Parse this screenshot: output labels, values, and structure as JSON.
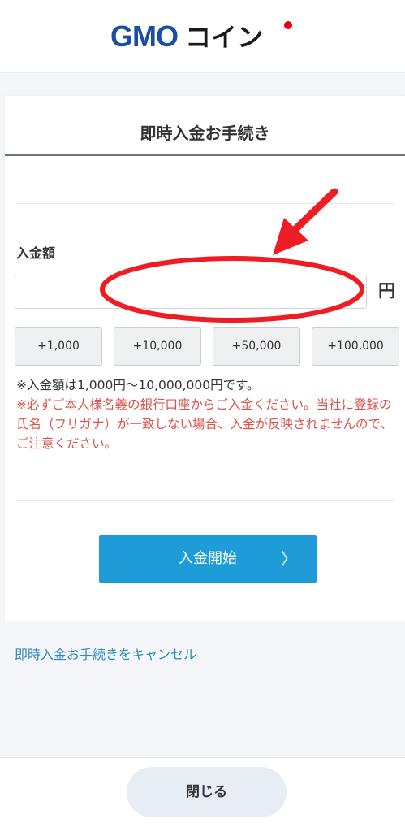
{
  "brand": {
    "logo_text": "GMOコイン",
    "logo_color": "#1a4ea2",
    "dot_color": "#e60012"
  },
  "card": {
    "title": "即時入金お手続き",
    "amount_label": "入金額",
    "amount_value": "",
    "unit": "円",
    "presets": [
      "+1,000",
      "+10,000",
      "+50,000",
      "+100,000"
    ],
    "note": "※入金額は1,000円〜10,000,000円です。",
    "warning": "※必ずご本人様名義の銀行口座からご入金ください。当社に登録の氏名（フリガナ）が一致しない場合、入金が反映されませんので、ご注意ください。",
    "start_button": "入金開始",
    "start_chevron": "〉"
  },
  "cancel_link": "即時入金お手続きをキャンセル",
  "footer": {
    "close_button": "閉じる"
  },
  "colors": {
    "accent": "#1d9cd8",
    "warning": "#d9534a",
    "annotation": "#ee1c25"
  },
  "icons": {
    "chevron": "chevron-right-icon"
  }
}
